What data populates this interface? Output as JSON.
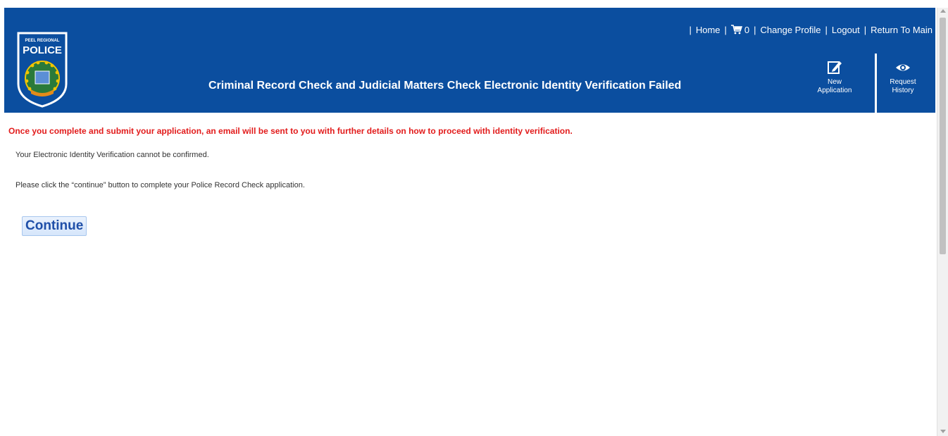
{
  "header": {
    "logo_text": "PEEL REGIONAL POLICE",
    "title": "Criminal Record Check and Judicial Matters Check Electronic Identity Verification Failed",
    "nav": {
      "home": "Home",
      "cart_count": "0",
      "change_profile": "Change Profile",
      "logout": "Logout",
      "return_main": "Return To Main",
      "separator": "|"
    },
    "tools": {
      "new_application": "New Application",
      "request_history": "Request History"
    }
  },
  "main": {
    "alert": "Once you complete and submit your application, an email will be sent to you with further details on how to proceed with identity verification.",
    "message1": "Your Electronic Identity Verification cannot be confirmed.",
    "message2": "Please click the “continue” button to complete your Police Record Check application.",
    "continue_label": "Continue"
  },
  "colors": {
    "header_bg": "#0b4e9f",
    "alert_red": "#e21b1b",
    "button_text": "#1f4fa8"
  }
}
